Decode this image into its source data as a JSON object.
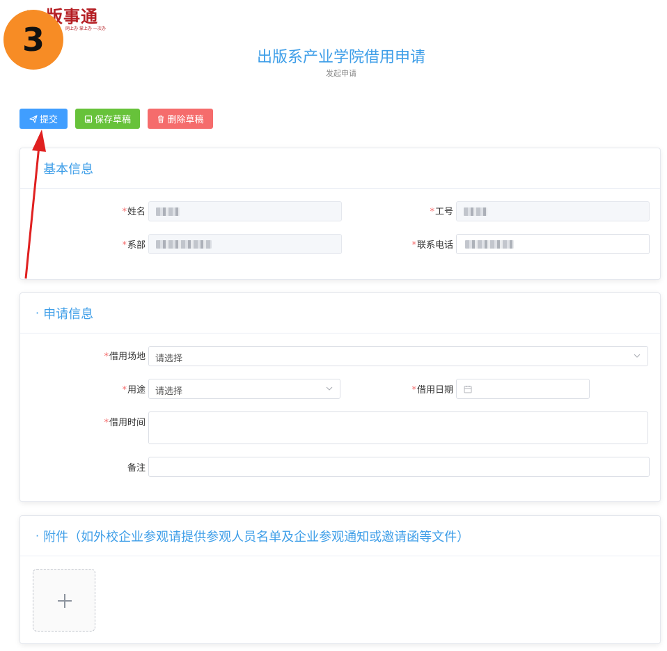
{
  "logo": {
    "text": "版事通",
    "slogan": "网上办 掌上办 一次办",
    "color": "#b51f24"
  },
  "step_badge": {
    "number": "3",
    "color": "#f78c25"
  },
  "header": {
    "title": "出版系产业学院借用申请",
    "subtitle": "发起申请"
  },
  "toolbar": {
    "submit_label": "提交",
    "save_label": "保存草稿",
    "delete_label": "删除草稿",
    "colors": {
      "submit": "#409eff",
      "save": "#67c23a",
      "delete": "#f56c6c"
    }
  },
  "basic_info": {
    "title": "基本信息",
    "name_label": "姓名",
    "staff_id_label": "工号",
    "department_label": "系部",
    "phone_label": "联系电话"
  },
  "apply_info": {
    "title": "申请信息",
    "venue_label": "借用场地",
    "venue_placeholder": "请选择",
    "purpose_label": "用途",
    "purpose_placeholder": "请选择",
    "date_label": "借用日期",
    "time_label": "借用时间",
    "remark_label": "备注"
  },
  "attachment": {
    "title": "附件（如外校企业参观请提供参观人员名单及企业参观通知或邀请函等文件）"
  },
  "required_mark": "*",
  "accent_color": "#3e9ee8",
  "annotation_arrow_color": "#e02020"
}
